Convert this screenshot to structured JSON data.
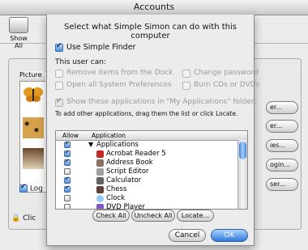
{
  "window": {
    "title": "Accounts"
  },
  "toolbar": {
    "show_all_label": "Show All"
  },
  "background": {
    "pictures_header": "Picture",
    "log_label": "Log",
    "lock_label": "Clic",
    "buttons": [
      "er...",
      "er...",
      "ies...",
      "ogin...",
      "ser..."
    ]
  },
  "sheet": {
    "title": "Select what Simple Simon can do with this computer",
    "use_simple_finder": {
      "label": "Use Simple Finder",
      "checked": true
    },
    "user_can_label": "This user can:",
    "permissions": [
      {
        "label": "Remove items from the Dock",
        "checked": false,
        "enabled": false
      },
      {
        "label": "Open all System Preferences",
        "checked": false,
        "enabled": false
      },
      {
        "label": "Change password",
        "checked": false,
        "enabled": false
      },
      {
        "label": "Burn CDs or DVDs",
        "checked": false,
        "enabled": false
      }
    ],
    "show_apps": {
      "label": "Show these applications in \"My Applications\" folder:",
      "checked": true,
      "enabled": false
    },
    "instructions": "To add other applications, drag them the list or click Locate.",
    "list": {
      "headers": {
        "allow": "Allow",
        "application": "Application"
      },
      "rows": [
        {
          "name": "Applications",
          "checked": true,
          "folder": true,
          "icon_color": "#e1e1e1"
        },
        {
          "name": "Acrobat Reader 5",
          "checked": true,
          "icon_color": "#c62828"
        },
        {
          "name": "Address Book",
          "checked": true,
          "icon_color": "#8d6e63"
        },
        {
          "name": "Script Editor",
          "checked": false,
          "icon_color": "#9e9e9e"
        },
        {
          "name": "Calculator",
          "checked": true,
          "icon_color": "#616161"
        },
        {
          "name": "Chess",
          "checked": true,
          "icon_color": "#5d4037"
        },
        {
          "name": "Clock",
          "checked": false,
          "icon_color": "#90caf9"
        },
        {
          "name": "DVD Player",
          "checked": false,
          "icon_color": "#7e57c2"
        }
      ]
    },
    "buttons": {
      "check_all": "Check All",
      "uncheck_all": "Uncheck All",
      "locate": "Locate...",
      "cancel": "Cancel",
      "ok": "OK"
    }
  }
}
